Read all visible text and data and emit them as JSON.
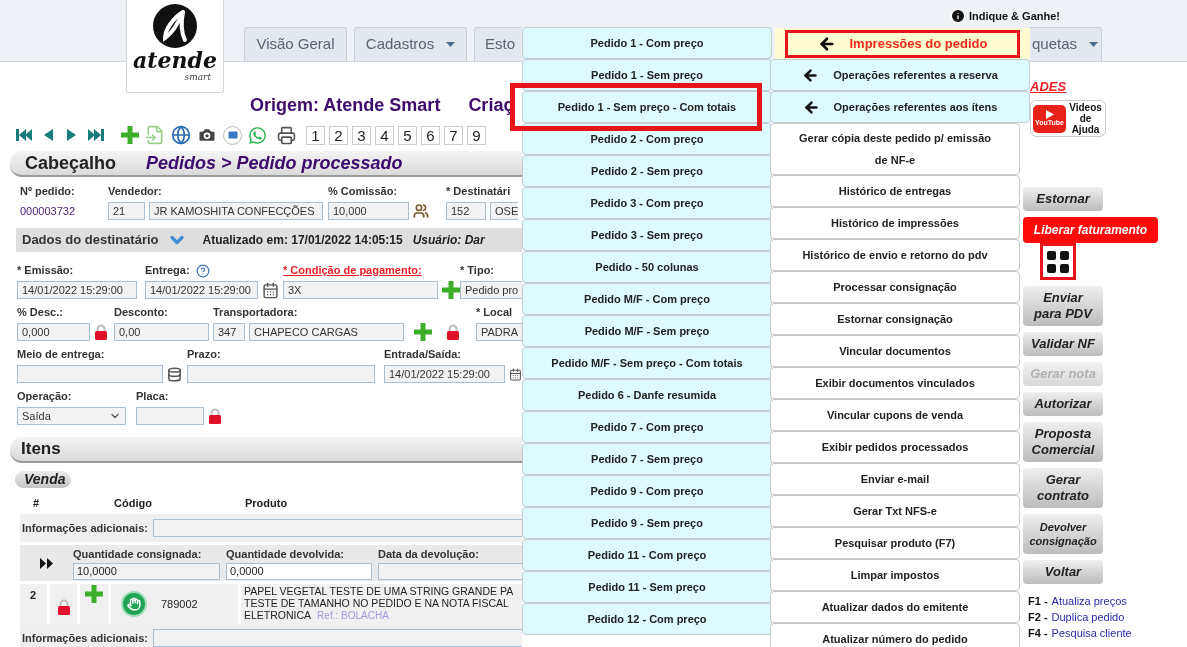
{
  "logo": {
    "name": "atende",
    "tagline": "smart"
  },
  "referral_link": "Indique & Ganhe!",
  "tabs": [
    {
      "label": "Visão Geral",
      "dropdown": false
    },
    {
      "label": "Cadastros",
      "dropdown": true
    },
    {
      "label": "Esto",
      "dropdown": false
    },
    {
      "label": "quetas",
      "dropdown": true
    }
  ],
  "origin": "Origem: Atende Smart",
  "created": "Criaç",
  "pages": [
    "1",
    "2",
    "3",
    "4",
    "5",
    "6",
    "7",
    "9"
  ],
  "section": {
    "title": "Cabeçalho",
    "path": "Pedidos > Pedido processado"
  },
  "order_fields": [
    {
      "kind": "text",
      "label": "Nº pedido:",
      "values": [
        "000003732"
      ]
    },
    {
      "kind": "input",
      "label": "Vendedor:",
      "values": [
        "21",
        "JR KAMOSHITA CONFECÇÕES"
      ]
    },
    {
      "kind": "input",
      "label": "% Comissão:",
      "values": [
        "10,000"
      ]
    },
    {
      "kind": "input",
      "label": "* Destinatári",
      "values": [
        "152",
        "OSE"
      ]
    }
  ],
  "recipient_bar": {
    "title": "Dados do destinatário",
    "updated": "Atualizado em: 17/01/2022 14:05:15",
    "user": "Usuário: Dar"
  },
  "form_rows": [
    [
      {
        "kind": "input",
        "label": "* Emissão:",
        "link": false,
        "values": [
          "14/01/2022 15:29:00"
        ]
      },
      {
        "kind": "input",
        "label": "Entrega:",
        "link": false,
        "values": [
          "14/01/2022 15:29:00"
        ]
      },
      {
        "kind": "input",
        "label": "* Condição de pagamento:",
        "link": true,
        "values": [
          "3X"
        ]
      },
      {
        "kind": "input",
        "label": "* Tipo:",
        "link": false,
        "values": [
          "Pedido pro"
        ]
      }
    ],
    [
      {
        "kind": "input",
        "label": "% Desc.:",
        "link": false,
        "values": [
          "0,000"
        ]
      },
      {
        "kind": "input",
        "label": "Desconto:",
        "link": false,
        "values": [
          "0,00"
        ]
      },
      {
        "kind": "input",
        "label": "Transportadora:",
        "link": false,
        "values": [
          "347",
          "CHAPECO CARGAS"
        ]
      },
      {
        "kind": "input",
        "label": "* Local",
        "link": false,
        "values": [
          "PADRA"
        ]
      }
    ],
    [
      {
        "kind": "input",
        "label": "Meio de entrega:",
        "link": false
      },
      {
        "kind": "input",
        "label": "Prazo:",
        "link": false
      },
      {
        "kind": "input",
        "label": "Entrada/Saída:",
        "link": false,
        "values": [
          "14/01/2022 15:29:00"
        ]
      }
    ],
    [
      {
        "kind": "select",
        "label": "Operação:",
        "link": false,
        "values": [
          "Saída"
        ]
      },
      {
        "kind": "input",
        "label": "Placa:",
        "link": false
      }
    ]
  ],
  "items": {
    "title": "Itens",
    "category": "Venda",
    "columns": [
      "#",
      "Código",
      "Produto"
    ],
    "lines": [
      {
        "kind": "info",
        "label": "Informações adicionais:"
      },
      {
        "kind": "consignment",
        "fields": [
          {
            "label": "Quantidade consignada:",
            "value": "10,0000",
            "editable": false
          },
          {
            "label": "Quantidade devolvida:",
            "value": "0,0000",
            "editable": true
          },
          {
            "label": "Data da devolução:",
            "editable": false
          }
        ]
      },
      {
        "kind": "product",
        "number": "2",
        "code": "789002",
        "description": "PAPEL VEGETAL TESTE DE UMA STRING GRANDE PA\nTESTE DE TAMANHO NO PEDIDO E NA NOTA FISCAL\nELETRONICA",
        "reference": "Ref.: BOLACHA"
      },
      {
        "kind": "info",
        "label": "Informações adicionais:"
      }
    ]
  },
  "print_menu": {
    "title": "Impressões do pedido",
    "highlighted": true,
    "items": [
      {
        "label": "Pedido 1 - Com preço",
        "highlighted": false
      },
      {
        "label": "Pedido 1 - Sem preço",
        "highlighted": false
      },
      {
        "label": "Pedido 1 - Sem preço - Com totais",
        "highlighted": true
      },
      {
        "label": "Pedido 2 - Com preço",
        "highlighted": false
      },
      {
        "label": "Pedido 2 - Sem preço",
        "highlighted": false
      },
      {
        "label": "Pedido 3 - Com preço",
        "highlighted": false
      },
      {
        "label": "Pedido 3 - Sem preço",
        "highlighted": false
      },
      {
        "label": "Pedido - 50 colunas",
        "highlighted": false
      },
      {
        "label": "Pedido M/F - Com preço",
        "highlighted": false
      },
      {
        "label": "Pedido M/F - Sem preço",
        "highlighted": false
      },
      {
        "label": "Pedido M/F - Sem preço - Com totais",
        "highlighted": false
      },
      {
        "label": "Pedido 6 - Danfe resumida",
        "highlighted": false
      },
      {
        "label": "Pedido 7 - Com preço",
        "highlighted": false
      },
      {
        "label": "Pedido 7 - Sem preço",
        "highlighted": false
      },
      {
        "label": "Pedido 9 - Com preço",
        "highlighted": false
      },
      {
        "label": "Pedido 9 - Sem preço",
        "highlighted": false
      },
      {
        "label": "Pedido 11 - Com preço",
        "highlighted": false
      },
      {
        "label": "Pedido 11 - Sem preço",
        "highlighted": false
      },
      {
        "label": "Pedido 12 - Com preço",
        "highlighted": false
      }
    ]
  },
  "order_menu": [
    {
      "kind": "submenu",
      "label": "Operações referentes a reserva"
    },
    {
      "kind": "submenu",
      "label": "Operações referentes aos ítens"
    },
    {
      "kind": "action",
      "label": "Gerar cópia deste pedido p/ emissão de NF-e"
    },
    {
      "kind": "action",
      "label": "Histórico de entregas"
    },
    {
      "kind": "action",
      "label": "Histórico de impressões"
    },
    {
      "kind": "action",
      "label": "Histórico de envio e retorno do pdv"
    },
    {
      "kind": "action",
      "label": "Processar consignação"
    },
    {
      "kind": "action",
      "label": "Estornar consignação"
    },
    {
      "kind": "action",
      "label": "Vincular documentos"
    },
    {
      "kind": "action",
      "label": "Exibir documentos vinculados"
    },
    {
      "kind": "action",
      "label": "Vincular cupons de venda"
    },
    {
      "kind": "action",
      "label": "Exibir pedidos processados"
    },
    {
      "kind": "action",
      "label": "Enviar e-mail"
    },
    {
      "kind": "action",
      "label": "Gerar Txt NFS-e"
    },
    {
      "kind": "action",
      "label": "Pesquisar produto (F7)"
    },
    {
      "kind": "action",
      "label": "Limpar impostos"
    },
    {
      "kind": "action",
      "label": "Atualizar dados do emitente"
    },
    {
      "kind": "action",
      "label": "Atualizar número do pedido"
    }
  ],
  "news_link": "ADES",
  "help_videos": {
    "brand": "YouTube",
    "label": "Videos de Ajuda"
  },
  "actions": [
    {
      "kind": "button",
      "label": "Estornar",
      "disabled": false
    },
    {
      "kind": "alert",
      "label": "Liberar faturamento",
      "disabled": false
    },
    {
      "kind": "apps",
      "highlighted": true
    },
    {
      "kind": "button",
      "label": "Enviar\npara PDV",
      "disabled": false
    },
    {
      "kind": "button",
      "label": "Validar NF",
      "disabled": false
    },
    {
      "kind": "button",
      "label": "Gerar nota",
      "disabled": true
    },
    {
      "kind": "button",
      "label": "Autorizar",
      "disabled": false
    },
    {
      "kind": "button",
      "label": "Proposta\nComercial",
      "disabled": false
    },
    {
      "kind": "button",
      "label": "Gerar\ncontrato",
      "disabled": false
    },
    {
      "kind": "compact",
      "label": "Devolver\nconsignação",
      "disabled": false
    },
    {
      "kind": "button",
      "label": "Voltar",
      "disabled": false
    }
  ],
  "shortcuts": [
    {
      "key": "F1 -",
      "action": "Atualiza preços"
    },
    {
      "key": "F2 -",
      "action": "Duplica pedido"
    },
    {
      "key": "F4 -",
      "action": "Pesquisa cliente"
    }
  ]
}
